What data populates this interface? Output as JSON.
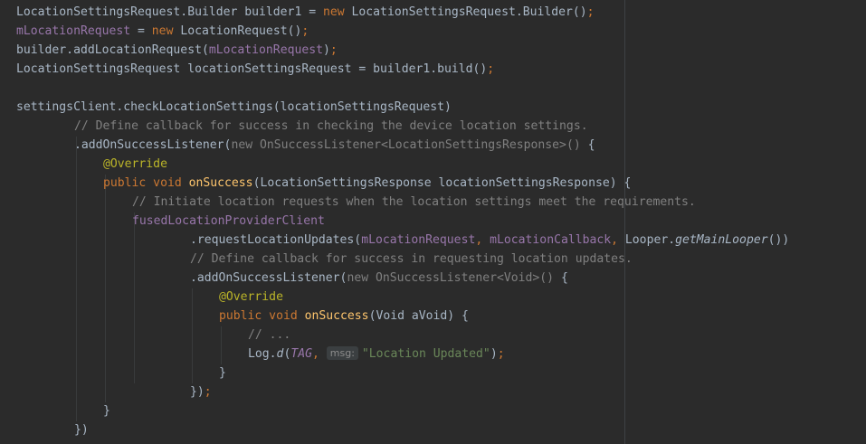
{
  "editor": {
    "lines": {
      "l1": {
        "a": "LocationSettingsRequest.Builder builder1 = ",
        "kw": "new",
        "b": " LocationSettingsRequest.Builder()",
        "semi": ";"
      },
      "l2": {
        "fld": "mLocationRequest",
        "a": " = ",
        "kw": "new",
        "b": " LocationRequest()",
        "semi": ";"
      },
      "l3": {
        "a": "builder.addLocationRequest(",
        "fld": "mLocationRequest",
        "b": ")",
        "semi": ";"
      },
      "l4": {
        "a": "LocationSettingsRequest locationSettingsRequest = builder1.build()",
        "semi": ";"
      },
      "l5": {
        "a": "settingsClient.checkLocationSettings(locationSettingsRequest)"
      },
      "l6": {
        "cmt": "// Define callback for success in checking the device location settings."
      },
      "l7": {
        "a": ".addOnSuccessListener(",
        "gen": "new OnSuccessListener<LocationSettingsResponse>()",
        "b": " {"
      },
      "l8": {
        "ann": "@Override"
      },
      "l9": {
        "kw": "public void",
        "sp": " ",
        "fn": "onSuccess",
        "b": "(LocationSettingsResponse locationSettingsResponse) {"
      },
      "l10": {
        "cmt": "// Initiate location requests when the location settings meet the requirements."
      },
      "l11": {
        "fld": "fusedLocationProviderClient"
      },
      "l12": {
        "a": ".requestLocationUpdates(",
        "fld1": "mLocationRequest",
        "c1": ",",
        "sp1": " ",
        "fld2": "mLocationCallback",
        "c2": ",",
        "b": " Looper.",
        "ital": "getMainLooper",
        "c": "())"
      },
      "l13": {
        "cmt": "// Define callback for success in requesting location updates."
      },
      "l14": {
        "a": ".addOnSuccessListener(",
        "gen": "new OnSuccessListener<Void>()",
        "b": " {"
      },
      "l15": {
        "ann": "@Override"
      },
      "l16": {
        "kw": "public void",
        "sp": " ",
        "fn": "onSuccess",
        "b": "(Void aVoid) {"
      },
      "l17": {
        "cmt": "// ..."
      },
      "l18": {
        "a": "Log.",
        "ital": "d",
        "b": "(",
        "fldi": "TAG",
        "c": ", ",
        "hint": "msg:",
        "str": "\"Location Updated\"",
        "d": ")",
        "semi": ";"
      },
      "l19": {
        "a": "}"
      },
      "l20": {
        "a": "})",
        "semi": ";"
      },
      "l21": {
        "a": "}"
      },
      "l22": {
        "a": "})"
      }
    }
  }
}
